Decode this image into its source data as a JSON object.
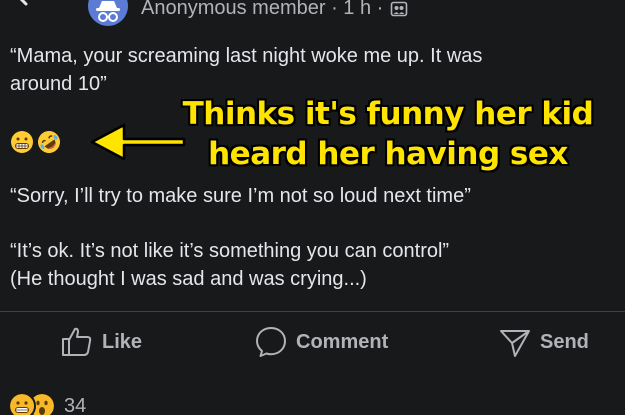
{
  "header": {
    "author_line": "Anonymous member · 1 h ·",
    "back_icon": "arrow-left-icon",
    "avatar_icon": "anonymous-incognito-icon",
    "group_icon": "group-icon"
  },
  "post": {
    "paragraph1": "“Mama, your screaming last night woke me up. It was\naround 10”",
    "emojis": [
      "grimacing-face-emoji",
      "rolling-on-floor-laughing-emoji"
    ],
    "paragraph2": "“Sorry, I’ll try to make sure I’m not so loud next time”",
    "paragraph3": "“It’s ok. It’s not like it’s something you can control”\n(He thought I was sad and was crying...)"
  },
  "annotation": {
    "line1": "Thinks it's funny her kid",
    "line2": "heard her having sex",
    "color": "#ffe400",
    "arrow_icon": "left-arrow-annotation-icon"
  },
  "actions": {
    "like_label": "Like",
    "comment_label": "Comment",
    "send_label": "Send",
    "like_icon": "thumbs-up-icon",
    "comment_icon": "speech-bubble-icon",
    "send_icon": "paper-plane-icon"
  },
  "reactions": {
    "icons": [
      "grimacing-reaction-icon",
      "wow-reaction-icon"
    ],
    "count": "34"
  },
  "colors": {
    "background": "#18191a",
    "text_primary": "#e4e6eb",
    "text_secondary": "#b0b3b8",
    "divider": "#3e4042",
    "reaction_yellow": "#f7b928"
  }
}
